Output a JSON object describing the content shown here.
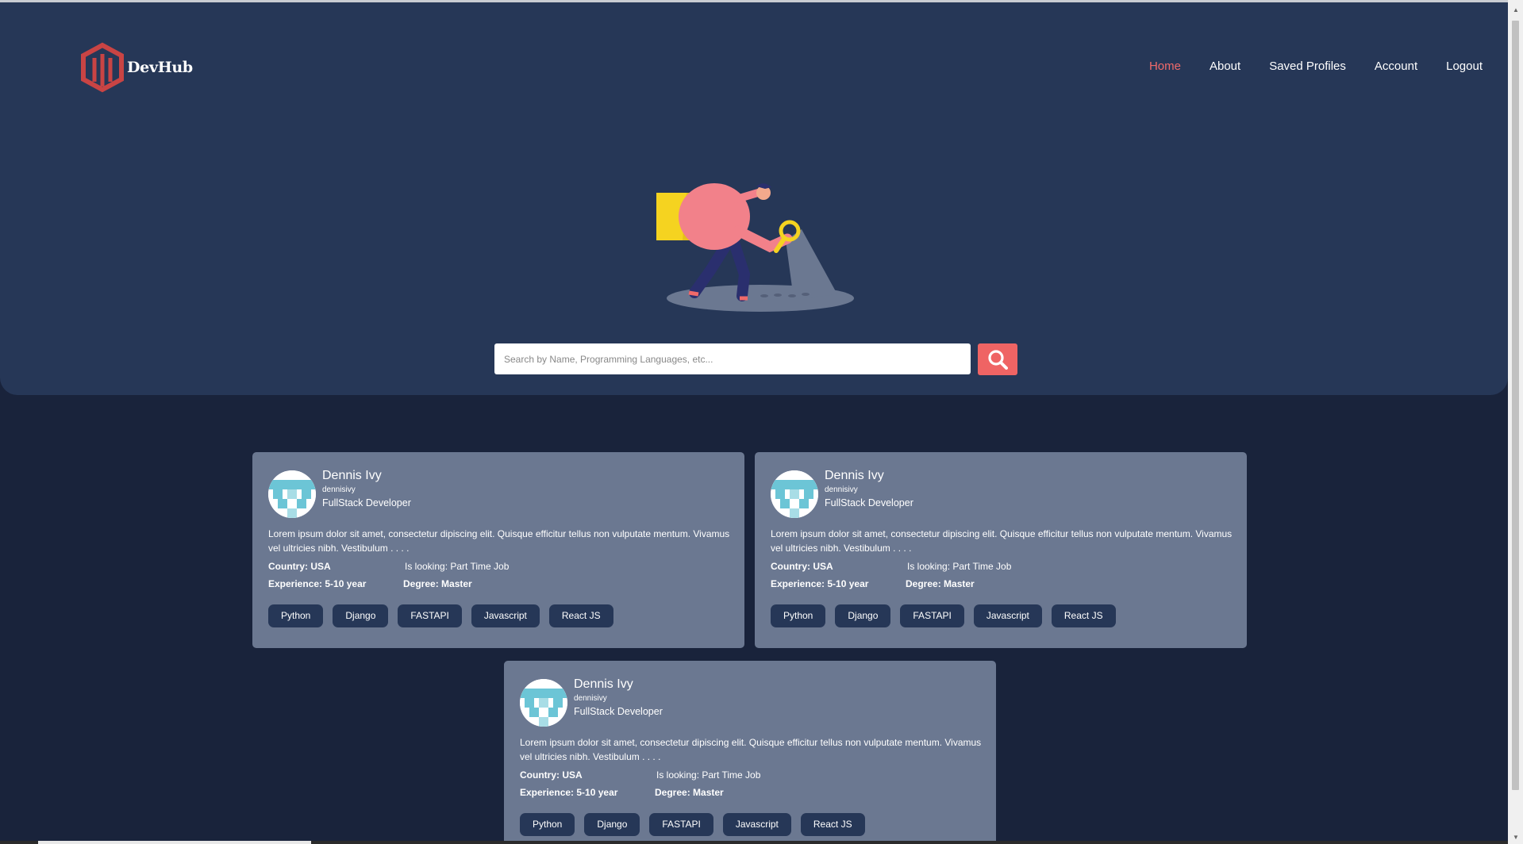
{
  "app": {
    "name": "DevHub"
  },
  "nav": [
    {
      "label": "Home",
      "active": true
    },
    {
      "label": "About"
    },
    {
      "label": "Saved Profiles"
    },
    {
      "label": "Account"
    },
    {
      "label": "Logout"
    }
  ],
  "search": {
    "placeholder": "Search by Name, Programming Languages, etc..."
  },
  "colors": {
    "accent": "#ef6464",
    "hero": "#263757",
    "page": "#19233b",
    "card": "#6b7891"
  },
  "icons": {
    "search_button": "search-icon",
    "logo": "hexagon-logo-icon"
  },
  "profiles": [
    {
      "name": "Dennis Ivy",
      "username": "dennisivy",
      "title": "FullStack Developer",
      "description": "Lorem ipsum dolor sit amet, consectetur dipiscing elit. Quisque efficitur tellus non vulputate mentum. Vivamus vel ultricies nibh. Vestibulum . . . .",
      "country": "Country: USA",
      "looking": "Is looking: Part Time Job",
      "experience": "Experience: 5-10 year",
      "degree": "Degree: Master",
      "skills": [
        "Python",
        "Django",
        "FASTAPI",
        "Javascript",
        "React JS"
      ]
    },
    {
      "name": "Dennis Ivy",
      "username": "dennisivy",
      "title": "FullStack Developer",
      "description": "Lorem ipsum dolor sit amet, consectetur dipiscing elit. Quisque efficitur tellus non vulputate mentum. Vivamus vel ultricies nibh. Vestibulum . . . .",
      "country": "Country: USA",
      "looking": "Is looking: Part Time Job",
      "experience": "Experience: 5-10 year",
      "degree": "Degree: Master",
      "skills": [
        "Python",
        "Django",
        "FASTAPI",
        "Javascript",
        "React JS"
      ]
    },
    {
      "name": "Dennis Ivy",
      "username": "dennisivy",
      "title": "FullStack Developer",
      "description": "Lorem ipsum dolor sit amet, consectetur dipiscing elit. Quisque efficitur tellus non vulputate mentum. Vivamus vel ultricies nibh. Vestibulum . . . .",
      "country": "Country: USA",
      "looking": "Is looking: Part Time Job",
      "experience": "Experience: 5-10 year",
      "degree": "Degree: Master",
      "skills": [
        "Python",
        "Django",
        "FASTAPI",
        "Javascript",
        "React JS"
      ]
    }
  ]
}
